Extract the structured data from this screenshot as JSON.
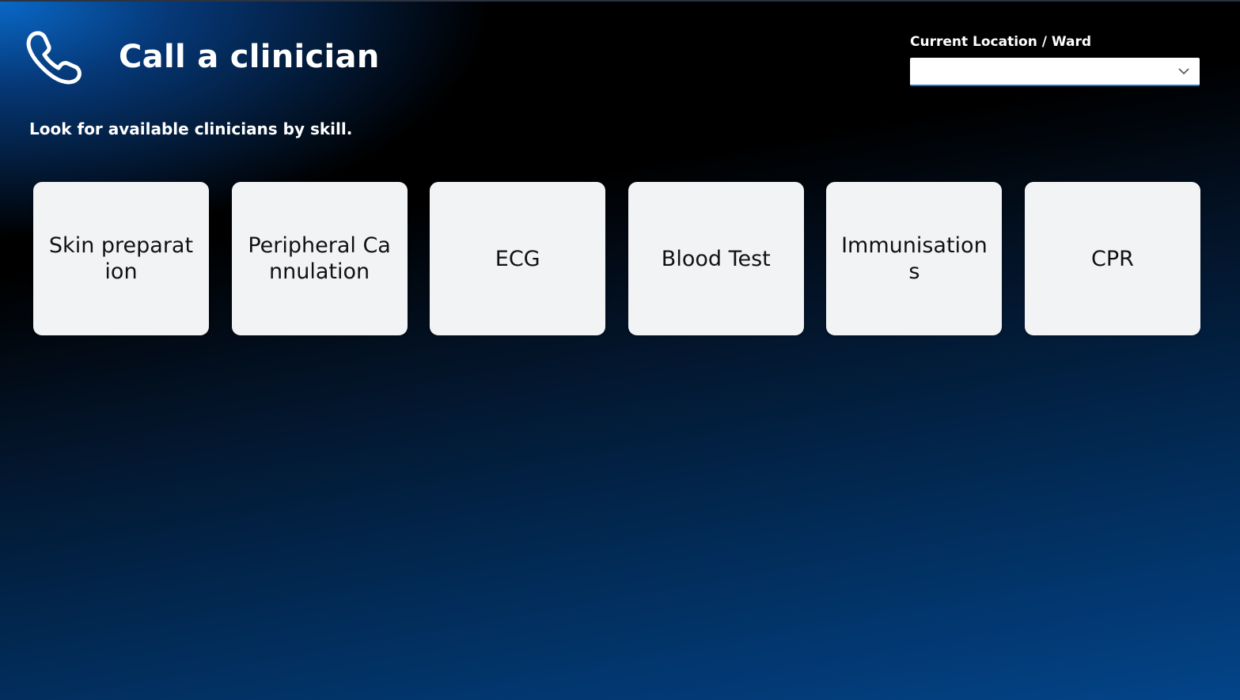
{
  "header": {
    "title": "Call a clinician",
    "icon": "phone-icon",
    "subtitle": "Look for available clinicians by skill."
  },
  "location": {
    "label": "Current Location / Ward",
    "value": "",
    "icon": "chevron-down-icon"
  },
  "skills": [
    {
      "label": "Skin preparation"
    },
    {
      "label": "Peripheral Cannulation"
    },
    {
      "label": "ECG"
    },
    {
      "label": "Blood Test"
    },
    {
      "label": "Immunisations"
    },
    {
      "label": "CPR"
    }
  ],
  "colors": {
    "background_top_glow": "#0a6ed2",
    "background_bottom": "#034489",
    "card": "#f2f3f5",
    "select_underline": "#1a76d2"
  }
}
